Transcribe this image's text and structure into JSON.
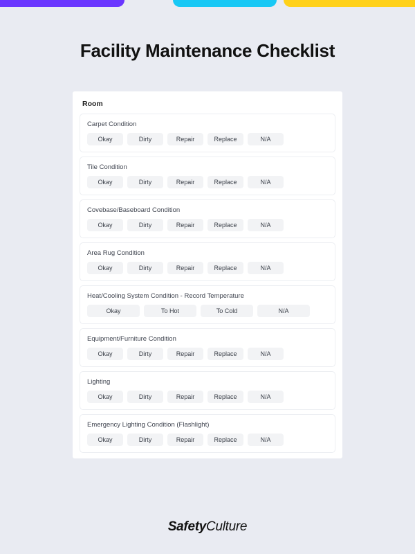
{
  "title": "Facility Maintenance Checklist",
  "section": "Room",
  "options_std": [
    "Okay",
    "Dirty",
    "Repair",
    "Replace",
    "N/A"
  ],
  "options_temp": [
    "Okay",
    "To Hot",
    "To Cold",
    "N/A"
  ],
  "items": [
    {
      "label": "Carpet Condition",
      "opts": "std"
    },
    {
      "label": "Tile Condition",
      "opts": "std"
    },
    {
      "label": "Covebase/Baseboard Condition",
      "opts": "std"
    },
    {
      "label": "Area Rug Condition",
      "opts": "std"
    },
    {
      "label": "Heat/Cooling System Condition - Record Temperature",
      "opts": "temp"
    },
    {
      "label": "Equipment/Furniture Condition",
      "opts": "std"
    },
    {
      "label": "Lighting",
      "opts": "std"
    },
    {
      "label": "Emergency Lighting Condition (Flashlight)",
      "opts": "std"
    }
  ],
  "brand": {
    "bold": "Safety",
    "light": "Culture"
  }
}
